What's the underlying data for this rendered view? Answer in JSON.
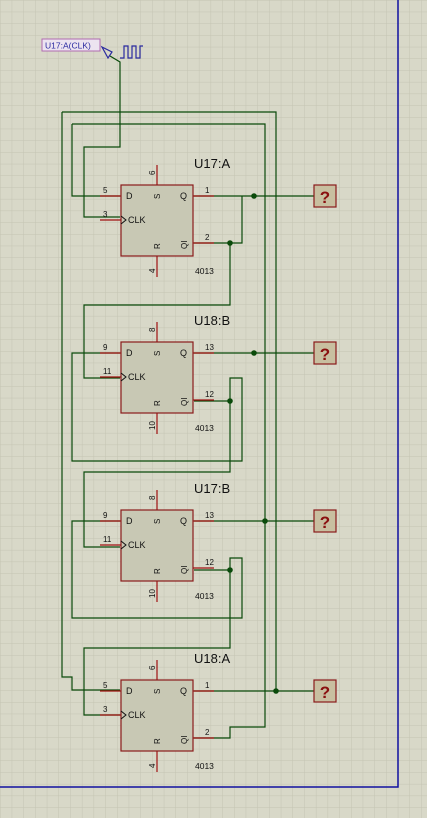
{
  "clock_label": "U17:A(CLK)",
  "chip_type": "4013",
  "probe_symbol": "?",
  "flipflops": [
    {
      "ref": "U17:A",
      "pin_d": "5",
      "pin_clk": "3",
      "pin_s": "6",
      "pin_r": "4",
      "pin_q": "1",
      "pin_qi": "2",
      "label_d": "D",
      "label_clk": "CLK",
      "label_s": "S",
      "label_r": "R",
      "label_q": "Q",
      "label_qi": "QI"
    },
    {
      "ref": "U18:B",
      "pin_d": "9",
      "pin_clk": "11",
      "pin_s": "8",
      "pin_r": "10",
      "pin_q": "13",
      "pin_qi": "12",
      "label_d": "D",
      "label_clk": "CLK",
      "label_s": "S",
      "label_r": "R",
      "label_q": "Q",
      "label_qi": "QI"
    },
    {
      "ref": "U17:B",
      "pin_d": "9",
      "pin_clk": "11",
      "pin_s": "8",
      "pin_r": "10",
      "pin_q": "13",
      "pin_qi": "12",
      "label_d": "D",
      "label_clk": "CLK",
      "label_s": "S",
      "label_r": "R",
      "label_q": "Q",
      "label_qi": "QI"
    },
    {
      "ref": "U18:A",
      "pin_d": "5",
      "pin_clk": "3",
      "pin_s": "6",
      "pin_r": "4",
      "pin_q": "1",
      "pin_qi": "2",
      "label_d": "D",
      "label_clk": "CLK",
      "label_s": "S",
      "label_r": "R",
      "label_q": "Q",
      "label_qi": "QI"
    }
  ],
  "colors": {
    "background": "#d8d8c8",
    "grid": "#c4c4b2",
    "grid_major": "#b8b8a6",
    "wire": "#0a4a0a",
    "pin": "#a01010",
    "chip_fill": "#c8c8b4",
    "chip_border": "#8a1a1a",
    "text": "#111111",
    "probe_fill": "#c8bfa0",
    "probe_text": "#8a1010",
    "label_border": "#b06cb0",
    "label_fill": "#ece4f0",
    "label_text": "#2a2aa0",
    "sheet_border": "#1010a0"
  }
}
